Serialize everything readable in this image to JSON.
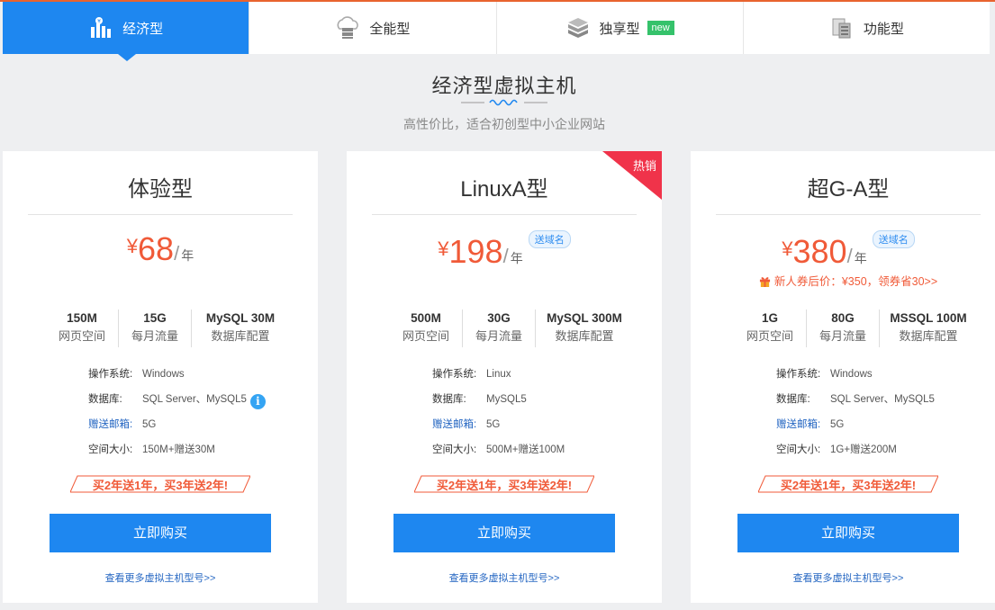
{
  "tabs": [
    {
      "label": "经济型",
      "icon": "bar-chart-icon",
      "active": true
    },
    {
      "label": "全能型",
      "icon": "cloud-server-icon"
    },
    {
      "label": "独享型",
      "icon": "cube-stack-icon",
      "badge": "new"
    },
    {
      "label": "功能型",
      "icon": "document-server-icon"
    }
  ],
  "section": {
    "title": "经济型虚拟主机",
    "subtitle": "高性价比，适合初创型中小企业网站"
  },
  "colors": {
    "accent": "#1e87f0",
    "price": "#f05a38",
    "hot": "#f0334a"
  },
  "cards": [
    {
      "title": "体验型",
      "price": {
        "yen": "¥",
        "value": "68",
        "slash": "/",
        "unit": "年"
      },
      "domain_tag": "",
      "coupon": "",
      "specs": [
        {
          "value": "150M",
          "label": "网页空间"
        },
        {
          "value": "15G",
          "label": "每月流量"
        },
        {
          "value": "MySQL 30M",
          "label": "数据库配置"
        }
      ],
      "details": [
        {
          "label": "操作系统:",
          "value": "Windows"
        },
        {
          "label": "数据库:",
          "value": "SQL Server、MySQL5"
        },
        {
          "label": "赠送邮箱:",
          "value": "5G"
        },
        {
          "label": "空间大小:",
          "value": "150M+赠送30M"
        }
      ],
      "info_icon": "i",
      "promo": "买2年送1年，买3年送2年!",
      "buy_label": "立即购买",
      "more_label": "查看更多虚拟主机型号>>"
    },
    {
      "title": "LinuxA型",
      "hot_label": "热销",
      "price": {
        "yen": "¥",
        "value": "198",
        "slash": "/",
        "unit": "年"
      },
      "domain_tag": "送域名",
      "coupon": "",
      "specs": [
        {
          "value": "500M",
          "label": "网页空间"
        },
        {
          "value": "30G",
          "label": "每月流量"
        },
        {
          "value": "MySQL 300M",
          "label": "数据库配置"
        }
      ],
      "details": [
        {
          "label": "操作系统:",
          "value": "Linux"
        },
        {
          "label": "数据库:",
          "value": "MySQL5"
        },
        {
          "label": "赠送邮箱:",
          "value": "5G"
        },
        {
          "label": "空间大小:",
          "value": "500M+赠送100M"
        }
      ],
      "promo": "买2年送1年，买3年送2年!",
      "buy_label": "立即购买",
      "more_label": "查看更多虚拟主机型号>>"
    },
    {
      "title": "超G-A型",
      "price": {
        "yen": "¥",
        "value": "380",
        "slash": "/",
        "unit": "年"
      },
      "domain_tag": "送域名",
      "coupon": "新人券后价：¥350，领券省30>>",
      "specs": [
        {
          "value": "1G",
          "label": "网页空间"
        },
        {
          "value": "80G",
          "label": "每月流量"
        },
        {
          "value": "MSSQL 100M",
          "label": "数据库配置"
        }
      ],
      "details": [
        {
          "label": "操作系统:",
          "value": "Windows"
        },
        {
          "label": "数据库:",
          "value": "SQL Server、MySQL5"
        },
        {
          "label": "赠送邮箱:",
          "value": "5G"
        },
        {
          "label": "空间大小:",
          "value": "1G+赠送200M"
        }
      ],
      "promo": "买2年送1年，买3年送2年!",
      "buy_label": "立即购买",
      "more_label": "查看更多虚拟主机型号>>"
    }
  ]
}
